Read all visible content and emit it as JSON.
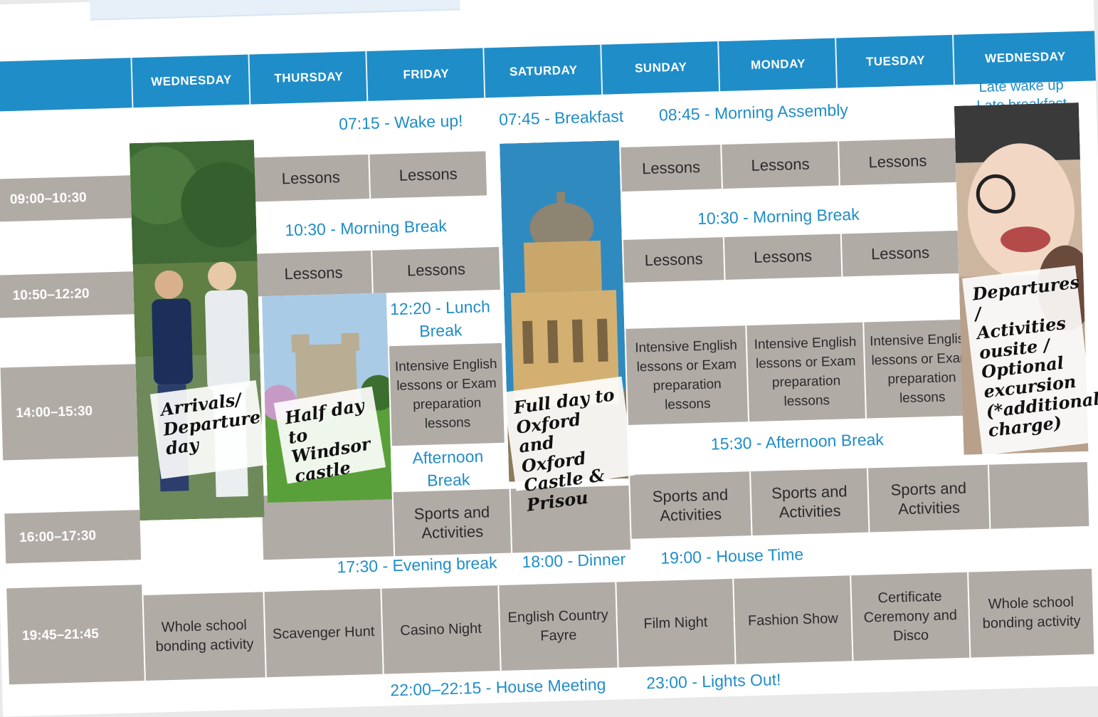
{
  "days": [
    "WEDNESDAY",
    "THURSDAY",
    "FRIDAY",
    "SATURDAY",
    "SUNDAY",
    "MONDAY",
    "TUESDAY",
    "WEDNESDAY"
  ],
  "times": [
    "09:00–10:30",
    "10:50–12:20",
    "14:00–15:30",
    "16:00–17:30",
    "19:45–21:45"
  ],
  "announcements": {
    "wake_up": "07:15 - Wake up!",
    "breakfast": "07:45 - Breakfast",
    "assembly": "08:45 - Morning Assembly",
    "late_wake": "Late wake up",
    "late_breakfast": "Late breakfast",
    "morning_break": "10:30 - Morning Break",
    "lunch_break": "12:20 - Lunch Break",
    "afternoon_break_short": "Afternoon Break",
    "afternoon_break": "15:30 - Afternoon Break",
    "evening_break": "17:30 - Evening break",
    "dinner": "18:00 - Dinner",
    "house_time": "19:00 - House Time",
    "house_meeting": "22:00–22:15 - House Meeting",
    "lights_out": "23:00 - Lights Out!"
  },
  "cells": {
    "lessons": "Lessons",
    "intensive": "Intensive English lessons or Exam preparation lessons",
    "sports": "Sports and Activities"
  },
  "evening": [
    "Whole school bonding activity",
    "Scavenger Hunt",
    "Casino Night",
    "English Country Fayre",
    "Film Night",
    "Fashion Show",
    "Certificate Ceremony and Disco",
    "Whole school bonding activity"
  ],
  "notes": {
    "arrivals": "Arrivals/ Departure day",
    "windsor": "Half day to Windsor castle",
    "oxford": "Full day to Oxford and Oxford Castle & Prisou",
    "departures": "Departures / Activities ousite / Optional excursion (*additional charge)"
  },
  "colors": {
    "brand_blue": "#1f8dc8",
    "cell_grey": "#b1aba6",
    "header_text": "#ffffff"
  }
}
